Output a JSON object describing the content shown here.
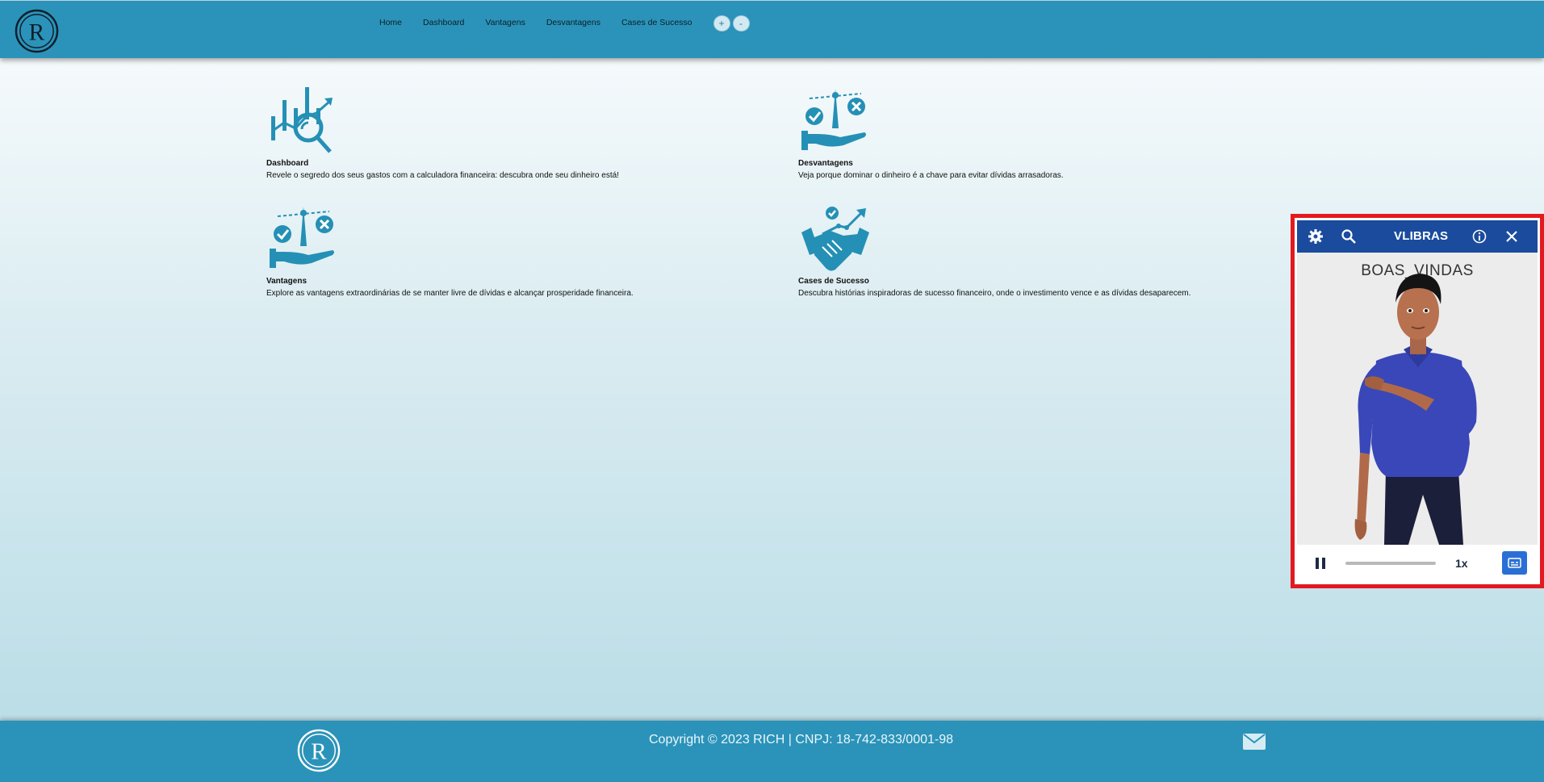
{
  "nav": {
    "items": [
      {
        "label": "Home"
      },
      {
        "label": "Dashboard"
      },
      {
        "label": "Vantagens"
      },
      {
        "label": "Desvantagens"
      },
      {
        "label": "Cases de Sucesso"
      }
    ],
    "zoom_in": "+",
    "zoom_out": "-"
  },
  "cards": {
    "dashboard": {
      "title": "Dashboard",
      "desc": "Revele o segredo dos seus gastos com a calculadora financeira: descubra onde seu dinheiro está!",
      "icon": "chart-magnifier-icon"
    },
    "desvantagens": {
      "title": "Desvantagens",
      "desc": "Veja porque dominar o dinheiro é a chave para evitar dívidas arrasadoras.",
      "icon": "scale-hand-icon"
    },
    "vantagens": {
      "title": "Vantagens",
      "desc": "Explore as vantagens extraordinárias de se manter livre de dívidas e alcançar prosperidade financeira.",
      "icon": "scale-hand-icon"
    },
    "cases": {
      "title": "Cases de Sucesso",
      "desc": "Descubra histórias inspiradoras de sucesso financeiro, onde o investimento vence e as dívidas desaparecem.",
      "icon": "handshake-growth-icon"
    }
  },
  "vlibras": {
    "title": "VLIBRAS",
    "caption": "BOAS_VINDAS",
    "speed": "1x",
    "progress": 0
  },
  "footer": {
    "copyright": "Copyright © 2023 RICH | CNPJ: 18-742-833/0001-98"
  },
  "colors": {
    "brand": "#2b93b9",
    "icon": "#2590b5",
    "vlibras_bar": "#1a4b9d",
    "highlight": "#e3191f"
  }
}
